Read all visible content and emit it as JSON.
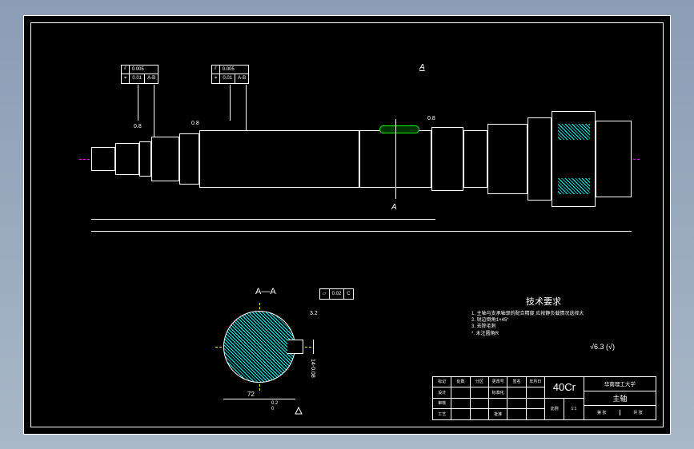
{
  "gdt": {
    "frame1": {
      "sym1": "⫽",
      "val1": "0.005",
      "sym2": "⌖",
      "val2": "0.01",
      "datum": "A-B"
    },
    "frame2": {
      "sym1": "⫽",
      "val1": "0.005",
      "sym2": "⌖",
      "val2": "0.01",
      "datum": "A-B"
    },
    "frame3": {
      "sym": "⏥",
      "val": "0.02",
      "datum": "C"
    }
  },
  "surface_finish": {
    "sf1": "0.8",
    "sf2": "0.8",
    "sf3": "0.8",
    "sf4": "6.3",
    "general": "√6.3   (√)"
  },
  "section_marks": {
    "top": "A",
    "bottom": "A",
    "title": "A—A"
  },
  "dimensions": {
    "d72": "72",
    "d14": "14-0.08",
    "tol1": "0.2",
    "tol2": "0",
    "sf_aa": "3.2"
  },
  "tech_requirements": {
    "title": "技术要求",
    "items": [
      "1. 主轴与支承轴颈的配合精度  应按静负载情况选择大",
      "2. 锐边倒角1×45°",
      "3. 去除毛刺",
      "*. 未注圆角R"
    ]
  },
  "title_block": {
    "material": "40Cr",
    "institution": "华南理工大学",
    "part_name": "主轴",
    "headers": [
      "标记",
      "处数",
      "分区",
      "更改号",
      "签名",
      "年月日"
    ],
    "rows_left": [
      "设计",
      "审核",
      "工艺",
      "标准化",
      "批准"
    ],
    "scale_label": "比例",
    "scale": "1:1",
    "sheet_label": "第 张",
    "total_label": "共 张"
  }
}
